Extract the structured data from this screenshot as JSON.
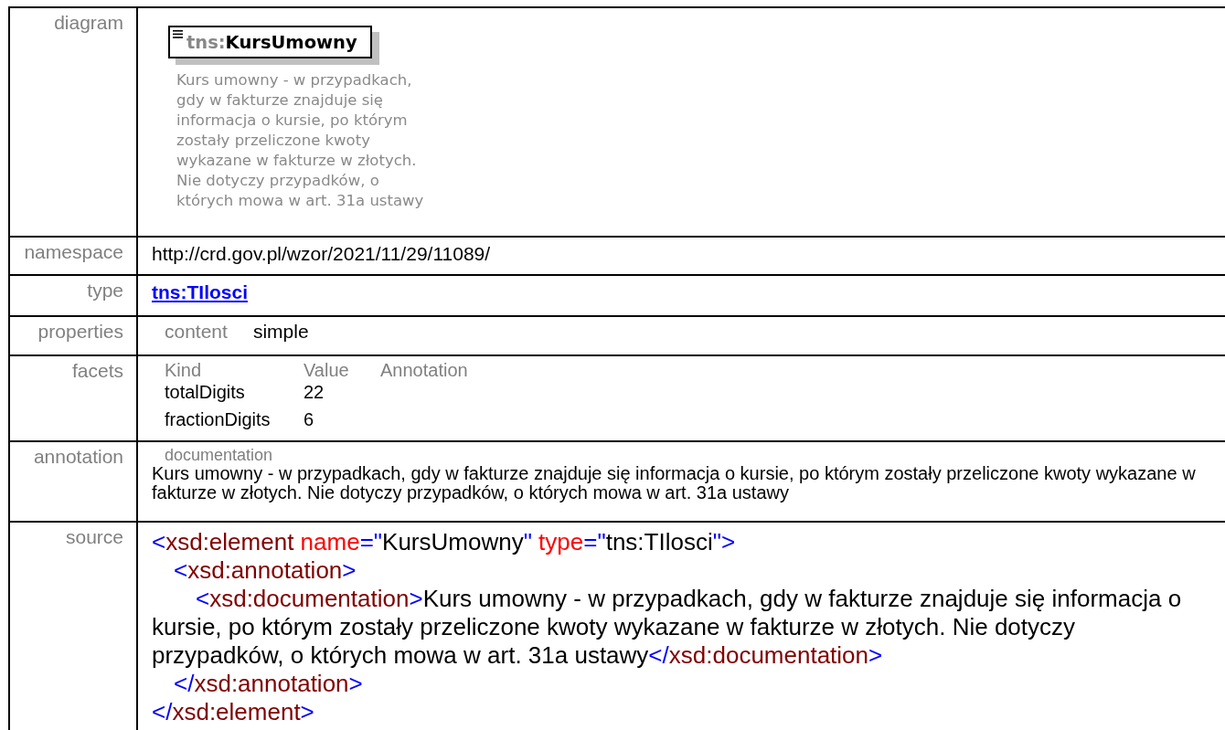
{
  "rows": [
    {
      "kind": "diagram",
      "label": "diagram",
      "element": {
        "prefix": "tns:",
        "name": "KursUmowny"
      },
      "description_lines": [
        "Kurs umowny - w przypadkach,",
        "gdy w fakturze znajduje się",
        "informacja o kursie, po którym",
        "zostały przeliczone kwoty",
        "wykazane w fakturze w złotych.",
        "Nie dotyczy przypadków, o",
        "których mowa w art. 31a ustawy"
      ]
    },
    {
      "kind": "text",
      "label": "namespace",
      "value": "http://crd.gov.pl/wzor/2021/11/29/11089/"
    },
    {
      "kind": "link",
      "label": "type",
      "value": "tns:TIlosci"
    },
    {
      "kind": "properties",
      "label": "properties",
      "items": [
        {
          "name": "content",
          "value": "simple"
        }
      ]
    },
    {
      "kind": "facets",
      "label": "facets",
      "columns": [
        "Kind",
        "Value",
        "Annotation"
      ],
      "items": [
        {
          "kind": "totalDigits",
          "value": "22"
        },
        {
          "kind": "fractionDigits",
          "value": "6"
        }
      ]
    },
    {
      "kind": "annotation",
      "label": "annotation",
      "heading": "documentation",
      "text": "Kurs umowny - w przypadkach, gdy w fakturze znajduje się informacja o kursie, po którym zostały przeliczone kwoty wykazane w fakturze w złotych. Nie dotyczy przypadków, o których mowa w art. 31a ustawy"
    },
    {
      "kind": "source",
      "label": "source",
      "node": {
        "open": [
          {
            "kind": "bracket",
            "text": "<"
          },
          {
            "kind": "tag",
            "text": "xsd:element"
          },
          {
            "kind": "attr",
            "text": " name"
          },
          {
            "kind": "bracket",
            "text": "=\""
          },
          {
            "kind": "value",
            "text": "KursUmowny"
          },
          {
            "kind": "bracket",
            "text": "\""
          },
          {
            "kind": "attr",
            "text": " type"
          },
          {
            "kind": "bracket",
            "text": "=\""
          },
          {
            "kind": "value",
            "text": "tns:TIlosci"
          },
          {
            "kind": "bracket",
            "text": "\">"
          }
        ],
        "children": [
          {
            "open": [
              {
                "kind": "bracket",
                "text": "<"
              },
              {
                "kind": "tag",
                "text": "xsd:annotation"
              },
              {
                "kind": "bracket",
                "text": ">"
              }
            ],
            "children": [
              {
                "open": [
                  {
                    "kind": "bracket",
                    "text": "<"
                  },
                  {
                    "kind": "tag",
                    "text": "xsd:documentation"
                  },
                  {
                    "kind": "bracket",
                    "text": ">"
                  }
                ],
                "text": "Kurs umowny - w przypadkach, gdy w fakturze znajduje się informacja o kursie, po którym zostały przeliczone kwoty wykazane w fakturze w złotych. Nie dotyczy przypadków, o których mowa w art. 31a ustawy",
                "close": [
                  {
                    "kind": "bracket",
                    "text": "</"
                  },
                  {
                    "kind": "tag",
                    "text": "xsd:documentation"
                  },
                  {
                    "kind": "bracket",
                    "text": ">"
                  }
                ]
              }
            ],
            "close": [
              {
                "kind": "bracket",
                "text": "</"
              },
              {
                "kind": "tag",
                "text": "xsd:annotation"
              },
              {
                "kind": "bracket",
                "text": ">"
              }
            ]
          }
        ],
        "close": [
          {
            "kind": "bracket",
            "text": "</"
          },
          {
            "kind": "tag",
            "text": "xsd:element"
          },
          {
            "kind": "bracket",
            "text": ">"
          }
        ]
      }
    }
  ]
}
